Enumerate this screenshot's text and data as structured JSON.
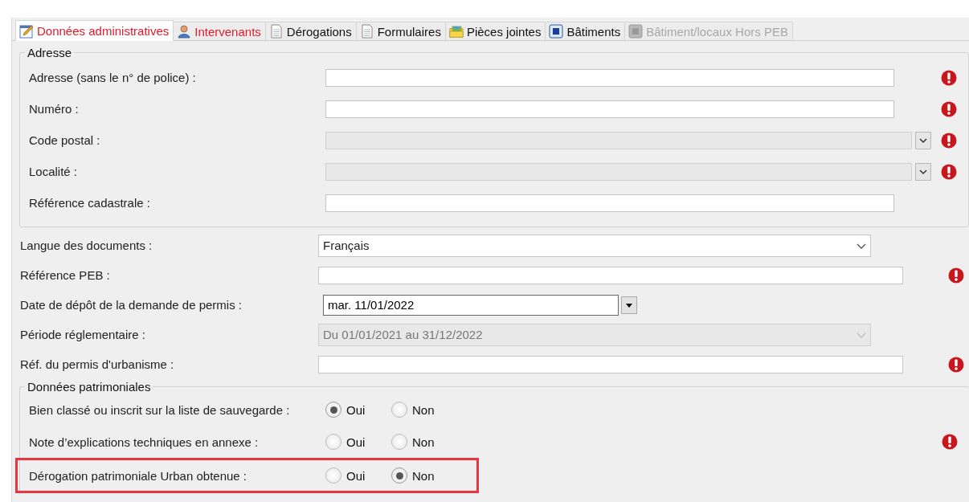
{
  "tabs": [
    {
      "label": "Données administratives",
      "kind": "edit",
      "selected": true,
      "alert": true,
      "disabled": false
    },
    {
      "label": "Intervenants",
      "kind": "person",
      "selected": false,
      "alert": true,
      "disabled": false
    },
    {
      "label": "Dérogations",
      "kind": "document",
      "selected": false,
      "alert": false,
      "disabled": false
    },
    {
      "label": "Formulaires",
      "kind": "document",
      "selected": false,
      "alert": false,
      "disabled": false
    },
    {
      "label": "Pièces jointes",
      "kind": "folder",
      "selected": false,
      "alert": false,
      "disabled": false
    },
    {
      "label": "Bâtiments",
      "kind": "cube",
      "selected": false,
      "alert": false,
      "disabled": false
    },
    {
      "label": "Bâtiment/locaux Hors PEB",
      "kind": "cube",
      "selected": false,
      "alert": false,
      "disabled": true
    }
  ],
  "address": {
    "legend": "Adresse",
    "fields": [
      {
        "label": "Adresse (sans le n° de police) :",
        "kind": "text",
        "disabled": false,
        "required": true
      },
      {
        "label": "Numéro :",
        "kind": "text",
        "disabled": false,
        "required": true
      },
      {
        "label": "Code postal :",
        "kind": "select",
        "disabled": true,
        "required": true
      },
      {
        "label": "Localité :",
        "kind": "select",
        "disabled": true,
        "required": true
      },
      {
        "label": "Référence cadastrale :",
        "kind": "text",
        "disabled": false,
        "required": false
      }
    ]
  },
  "fields": [
    {
      "label": "Langue des documents :",
      "kind": "select",
      "value": "Français",
      "disabled": false,
      "required": false
    },
    {
      "label": "Référence PEB :",
      "kind": "text",
      "disabled": false,
      "required": true
    },
    {
      "label": "Date de dépôt de la demande de permis :",
      "kind": "date",
      "value": "mar. 11/01/2022",
      "disabled": false,
      "required": false
    },
    {
      "label": "Période réglementaire :",
      "kind": "select",
      "value": "Du 01/01/2021 au 31/12/2022",
      "disabled": true,
      "required": false
    },
    {
      "label": "Réf. du permis d'urbanisme :",
      "kind": "text",
      "disabled": false,
      "required": true
    }
  ],
  "heritage": {
    "legend": "Données patrimoniales",
    "questions": [
      {
        "label": "Bien classé ou inscrit sur la liste de sauvegarde :",
        "required": false,
        "highlighted": false,
        "options": [
          {
            "label": "Oui",
            "selected": true
          },
          {
            "label": "Non",
            "selected": false
          }
        ]
      },
      {
        "label": "Note d’explications techniques en annexe :",
        "required": true,
        "highlighted": false,
        "options": [
          {
            "label": "Oui",
            "selected": false
          },
          {
            "label": "Non",
            "selected": false
          }
        ]
      },
      {
        "label": "Dérogation patrimoniale Urban obtenue :",
        "required": false,
        "highlighted": true,
        "options": [
          {
            "label": "Oui",
            "selected": false
          },
          {
            "label": "Non",
            "selected": true
          }
        ]
      }
    ]
  }
}
